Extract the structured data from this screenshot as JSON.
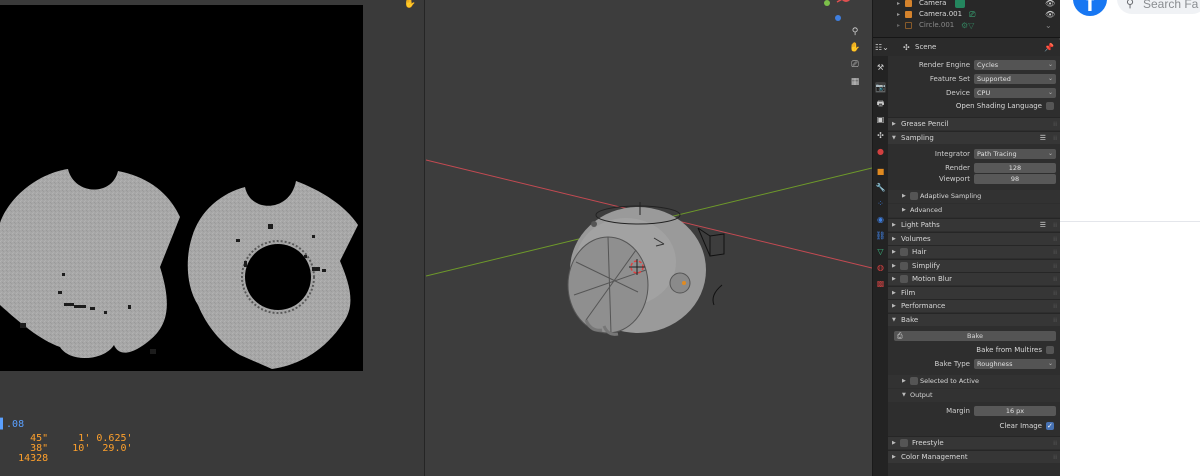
{
  "image_editor": {
    "hand_icon": "hand-icon",
    "stats": [
      {
        "c1": "45",
        "u1": "\"",
        "c2": "1",
        "u2": "'",
        "c3": "0.625",
        "u3": "'"
      },
      {
        "c1": "38",
        "u1": "\"",
        "c2": "10",
        "u2": "'",
        "c3": "29.0",
        "u3": "'"
      }
    ],
    "stat_top": ".08",
    "stat_bottom": "14328"
  },
  "outliner": {
    "items": [
      {
        "label": "Camera"
      },
      {
        "label": "Camera.001"
      },
      {
        "label": "Circle.001"
      }
    ]
  },
  "properties": {
    "context_label": "Scene",
    "render_engine_label": "Render Engine",
    "render_engine_value": "Cycles",
    "feature_set_label": "Feature Set",
    "feature_set_value": "Supported",
    "device_label": "Device",
    "device_value": "CPU",
    "osl_label": "Open Shading Language",
    "panels": {
      "grease_pencil": "Grease Pencil",
      "sampling": "Sampling",
      "adaptive_sampling": "Adaptive Sampling",
      "advanced": "Advanced",
      "light_paths": "Light Paths",
      "volumes": "Volumes",
      "hair": "Hair",
      "simplify": "Simplify",
      "motion_blur": "Motion Blur",
      "film": "Film",
      "performance": "Performance",
      "bake": "Bake",
      "selected_to_active": "Selected to Active",
      "output": "Output",
      "freestyle": "Freestyle",
      "color_management": "Color Management"
    },
    "integrator_label": "Integrator",
    "integrator_value": "Path Tracing",
    "render_label": "Render",
    "render_value": "128",
    "viewport_label": "Viewport",
    "viewport_value": "98",
    "bake_button": "Bake",
    "bake_multires_label": "Bake from Multires",
    "bake_type_label": "Bake Type",
    "bake_type_value": "Roughness",
    "margin_label": "Margin",
    "margin_value": "16 px",
    "clear_image_label": "Clear Image",
    "clear_image_checked": true
  },
  "browser": {
    "logo_letter": "f",
    "search_placeholder": "Search Fa"
  },
  "colors": {
    "x_axis": "#c44a52",
    "y_axis": "#6e9a2a",
    "accent": "#4772b3",
    "stats": "#ffa12c",
    "facebook": "#1877f2"
  }
}
